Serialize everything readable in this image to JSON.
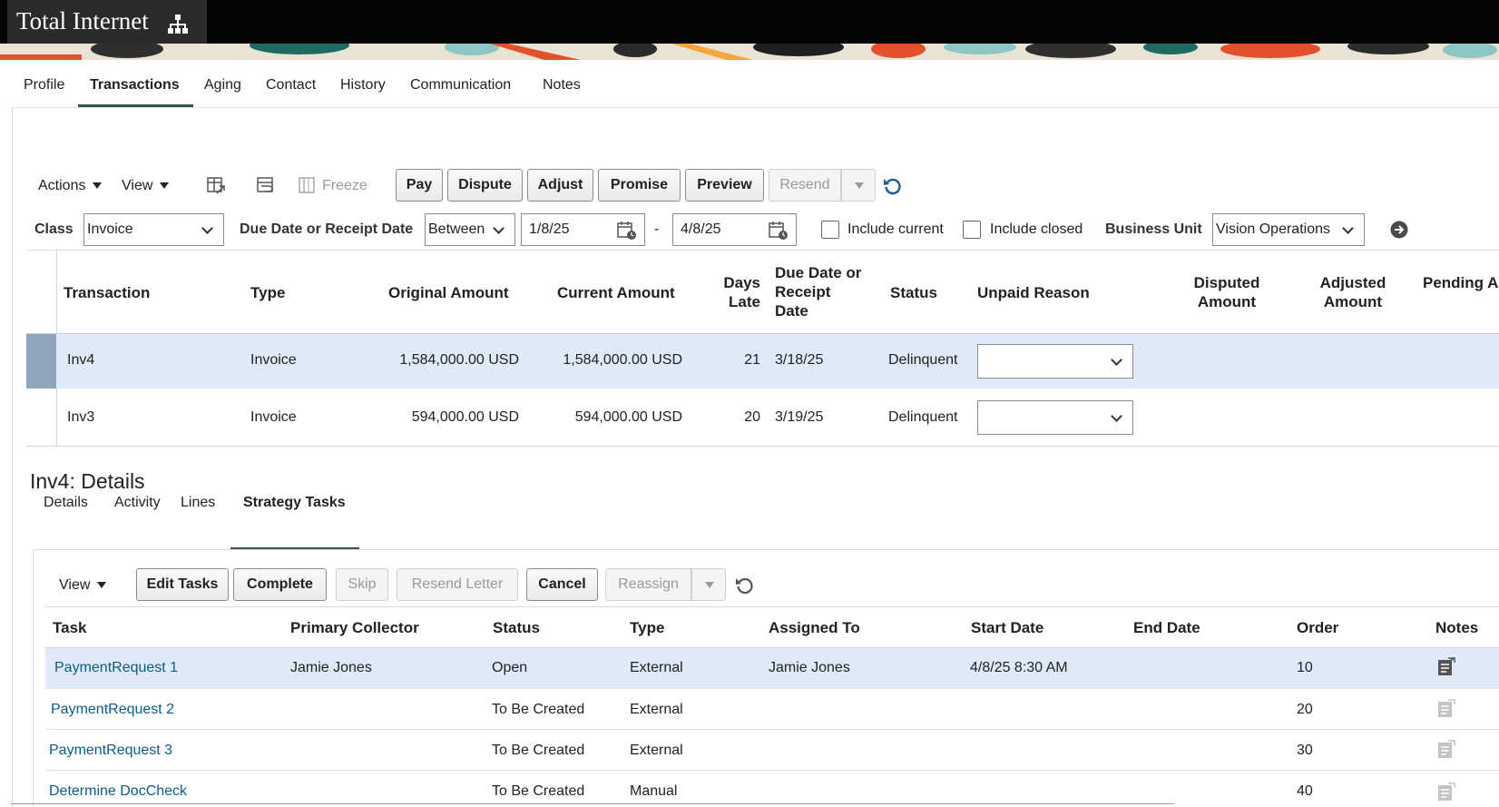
{
  "app": {
    "title": "Total Internet"
  },
  "main_tabs": [
    "Profile",
    "Transactions",
    "Aging",
    "Contact",
    "History",
    "Communication",
    "Notes"
  ],
  "toolbar": {
    "actions": "Actions",
    "view": "View",
    "freeze": "Freeze",
    "pay": "Pay",
    "dispute": "Dispute",
    "adjust": "Adjust",
    "promise": "Promise",
    "preview": "Preview",
    "resend": "Resend"
  },
  "filters": {
    "class_label": "Class",
    "class_value": "Invoice",
    "date_label": "Due Date or Receipt Date",
    "date_op": "Between",
    "date_from": "1/8/25",
    "dash": "-",
    "date_to": "4/8/25",
    "include_current": "Include current",
    "include_closed": "Include closed",
    "bu_label": "Business Unit",
    "bu_value": "Vision Operations"
  },
  "transactions": {
    "headers": {
      "transaction": "Transaction",
      "type": "Type",
      "original": "Original Amount",
      "current": "Current Amount",
      "days_late_1": "Days",
      "days_late_2": "Late",
      "due_1": "Due Date or",
      "due_2": "Receipt",
      "due_3": "Date",
      "status": "Status",
      "unpaid": "Unpaid Reason",
      "disputed_1": "Disputed",
      "disputed_2": "Amount",
      "adjusted_1": "Adjusted",
      "adjusted_2": "Amount",
      "pending": "Pending A"
    },
    "rows": [
      {
        "transaction": "Inv4",
        "type": "Invoice",
        "original": "1,584,000.00 USD",
        "current": "1,584,000.00 USD",
        "days_late": "21",
        "due": "3/18/25",
        "status": "Delinquent"
      },
      {
        "transaction": "Inv3",
        "type": "Invoice",
        "original": "594,000.00 USD",
        "current": "594,000.00 USD",
        "days_late": "20",
        "due": "3/19/25",
        "status": "Delinquent"
      }
    ]
  },
  "details": {
    "title": "Inv4: Details",
    "tabs": [
      "Details",
      "Activity",
      "Lines",
      "Strategy Tasks"
    ],
    "toolbar": {
      "view": "View",
      "edit_tasks": "Edit Tasks",
      "complete": "Complete",
      "skip": "Skip",
      "resend_letter": "Resend Letter",
      "cancel": "Cancel",
      "reassign": "Reassign"
    },
    "headers": {
      "task": "Task",
      "collector": "Primary Collector",
      "status": "Status",
      "type": "Type",
      "assigned": "Assigned To",
      "start": "Start Date",
      "end": "End Date",
      "order": "Order",
      "notes": "Notes"
    },
    "rows": [
      {
        "task": "PaymentRequest 1",
        "collector": "Jamie Jones",
        "status": "Open",
        "type": "External",
        "assigned": "Jamie Jones",
        "start": "4/8/25 8:30 AM",
        "end": "",
        "order": "10"
      },
      {
        "task": "PaymentRequest 2",
        "collector": "",
        "status": "To Be Created",
        "type": "External",
        "assigned": "",
        "start": "",
        "end": "",
        "order": "20"
      },
      {
        "task": "PaymentRequest 3",
        "collector": "",
        "status": "To Be Created",
        "type": "External",
        "assigned": "",
        "start": "",
        "end": "",
        "order": "30"
      },
      {
        "task": "Determine DocCheck",
        "collector": "",
        "status": "To Be Created",
        "type": "Manual",
        "assigned": "",
        "start": "",
        "end": "",
        "order": "40"
      }
    ]
  },
  "colors": {
    "selected_row": "#deeaf7",
    "link": "#0a5c8a",
    "tab_underline": "#33554a",
    "refresh_icon": "#1a5f9e"
  },
  "icons": [
    "org-chart-icon",
    "detach-icon",
    "wrap-icon",
    "freeze-icon",
    "refresh-icon",
    "calendar-icon",
    "go-arrow-icon",
    "note-icon"
  ]
}
